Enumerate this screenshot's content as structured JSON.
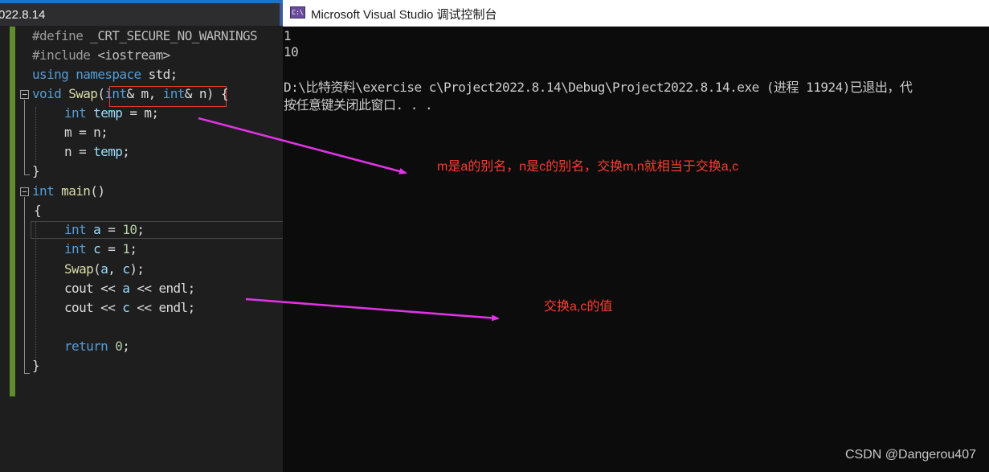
{
  "editor": {
    "tab_title": "022.8.14",
    "lines": {
      "l1": {
        "kw": "#define",
        "macro": "_CRT_SECURE_NO_WARNINGS"
      },
      "l2": {
        "kw": "#include",
        "hdr": "<iostream>"
      },
      "l3": {
        "kw1": "using",
        "kw2": "namespace",
        "rest": "std;"
      },
      "l4": {
        "ret": "void",
        "name": "Swap",
        "open": "(",
        "t1": "int",
        "p1": "& m, ",
        "t2": "int",
        "p2": "& n)",
        "tail": " {"
      },
      "l5": {
        "type": "int",
        "var": "temp",
        "rest": " = m;"
      },
      "l6": {
        "text": "m = n;"
      },
      "l7": {
        "pre": "n = ",
        "var": "temp",
        "post": ";"
      },
      "l8": {
        "text": "}"
      },
      "l9": {
        "ret": "int",
        "name": "main",
        "rest": "()"
      },
      "l10": {
        "text": "{"
      },
      "l11": {
        "type": "int",
        "var": "a",
        "eq": " = ",
        "num": "10",
        "end": ";"
      },
      "l12": {
        "type": "int",
        "var": "c",
        "eq": " = ",
        "num": "1",
        "end": ";"
      },
      "l13": {
        "fn": "Swap",
        "open": "(",
        "a": "a",
        "sep": ", ",
        "c": "c",
        "close": ");"
      },
      "l14": {
        "pre": "cout << ",
        "var": "a",
        "post": " << endl;"
      },
      "l15": {
        "pre": "cout << ",
        "var": "c",
        "post": " << endl;"
      },
      "l17": {
        "kw": "return",
        "num": " 0",
        "end": ";"
      },
      "l18": {
        "text": "}"
      }
    }
  },
  "console": {
    "title": "Microsoft Visual Studio 调试控制台",
    "icon_label": "C:\\",
    "output": [
      "1",
      "10",
      "",
      "D:\\比特资料\\exercise c\\Project2022.8.14\\Debug\\Project2022.8.14.exe (进程 11924)已退出，代",
      "按任意键关闭此窗口. . ."
    ]
  },
  "annotations": {
    "note1": "m是a的别名，n是c的别名，交换m,n就相当于交换a,c",
    "note2": "交换a,c的值"
  },
  "colors": {
    "annotation_text": "#ff3b30",
    "arrow": "#e233e6",
    "highlight_box": "#e53935"
  },
  "watermark": "CSDN @Dangerou407"
}
